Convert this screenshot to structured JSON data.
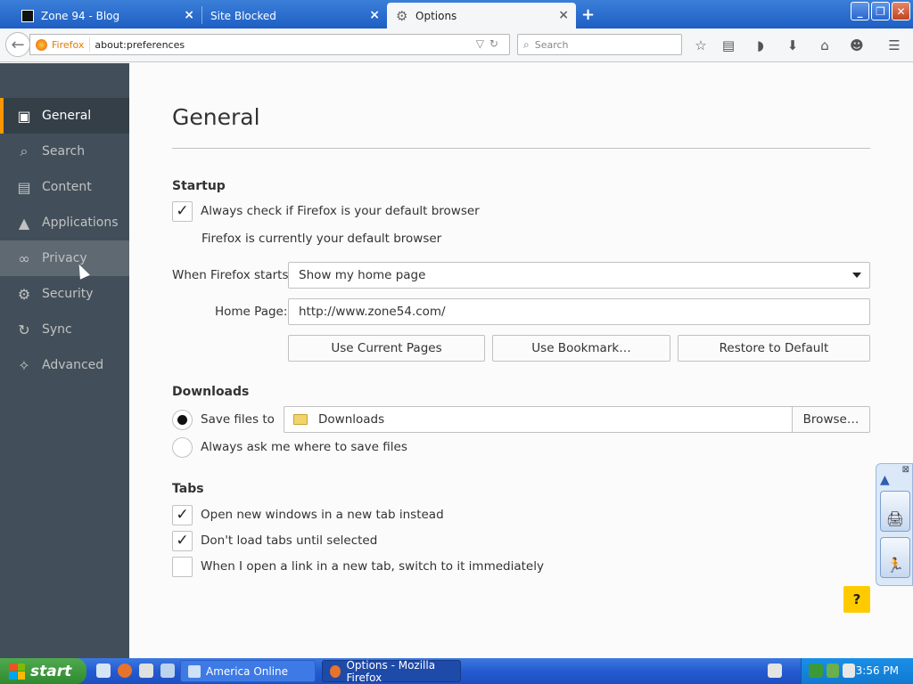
{
  "tabs": [
    {
      "title": "Zone 94 - Blog",
      "icon": "zone94-favicon",
      "active": false
    },
    {
      "title": "Site Blocked",
      "icon": "",
      "active": false
    },
    {
      "title": "Options",
      "icon": "gear-icon",
      "active": true
    }
  ],
  "urlbar": {
    "identity": "Firefox",
    "url": "about:preferences"
  },
  "search": {
    "placeholder": "Search"
  },
  "sidebar": {
    "items": [
      {
        "label": "General",
        "icon": "general-icon",
        "selected": true
      },
      {
        "label": "Search",
        "icon": "search-icon"
      },
      {
        "label": "Content",
        "icon": "content-icon"
      },
      {
        "label": "Applications",
        "icon": "applications-icon"
      },
      {
        "label": "Privacy",
        "icon": "privacy-icon",
        "hovered": true
      },
      {
        "label": "Security",
        "icon": "security-icon"
      },
      {
        "label": "Sync",
        "icon": "sync-icon"
      },
      {
        "label": "Advanced",
        "icon": "advanced-icon"
      }
    ]
  },
  "page": {
    "title": "General",
    "startup": {
      "heading": "Startup",
      "default_check": {
        "label": "Always check if Firefox is your default browser",
        "checked": true
      },
      "default_note": "Firefox is currently your default browser",
      "when_starts_label": "When Firefox starts:",
      "when_starts_value": "Show my home page",
      "home_page_label": "Home Page:",
      "home_page_value": "http://www.zone54.com/",
      "buttons": {
        "use_current": "Use Current Pages",
        "use_bookmark": "Use Bookmark…",
        "restore": "Restore to Default"
      }
    },
    "downloads": {
      "heading": "Downloads",
      "save_files_label": "Save files to",
      "save_files_selected": true,
      "folder": "Downloads",
      "browse": "Browse…",
      "ask_label": "Always ask me where to save files"
    },
    "tabs": {
      "heading": "Tabs",
      "items": [
        {
          "label": "Open new windows in a new tab instead",
          "checked": true
        },
        {
          "label": "Don't load tabs until selected",
          "checked": true
        },
        {
          "label": "When I open a link in a new tab, switch to it immediately",
          "checked": false
        }
      ]
    },
    "help": "?"
  },
  "taskbar": {
    "start": "start",
    "tasks": [
      {
        "label": "America  Online",
        "active": false
      },
      {
        "label": "Options - Mozilla Firefox",
        "active": true
      }
    ],
    "clock": "3:56 PM"
  },
  "colors": {
    "accent": "#ff9500",
    "sidebar": "#424f5a",
    "help": "#ffcb00",
    "titlebar": "#2b6bd0"
  }
}
